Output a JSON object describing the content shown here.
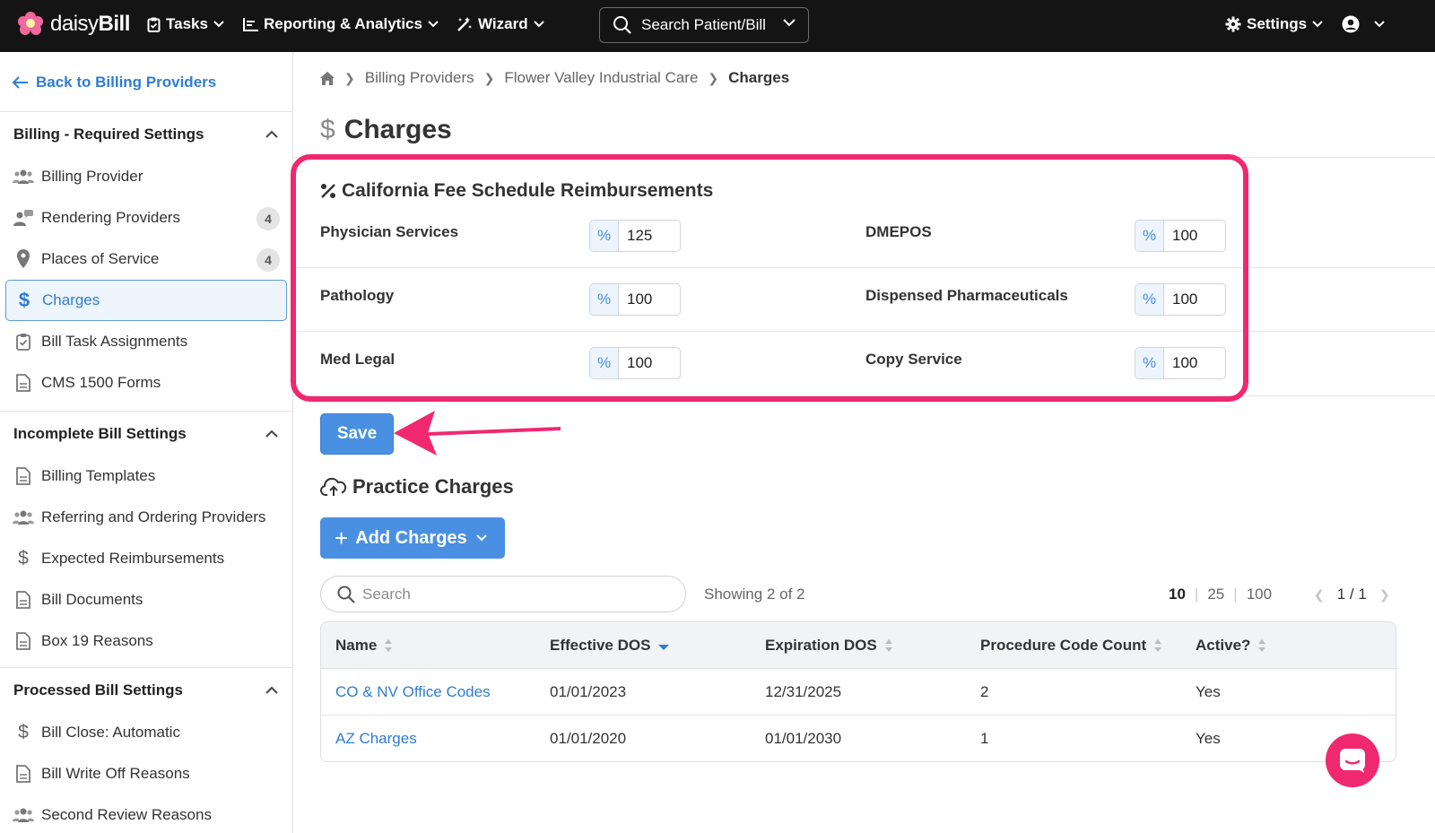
{
  "app": {
    "logo_text_light": "daisy",
    "logo_text_bold": "Bill"
  },
  "topnav": {
    "tasks": "Tasks",
    "reporting": "Reporting & Analytics",
    "wizard": "Wizard",
    "search_label": "Search Patient/Bill",
    "settings": "Settings"
  },
  "sidebar": {
    "back_link": "Back to Billing Providers",
    "sections": [
      {
        "title": "Billing - Required Settings",
        "items": [
          {
            "label": "Billing Provider",
            "icon": "users-icon"
          },
          {
            "label": "Rendering Providers",
            "icon": "user-chat-icon",
            "badge": "4"
          },
          {
            "label": "Places of Service",
            "icon": "map-pin-icon",
            "badge": "4"
          },
          {
            "label": "Charges",
            "icon": "dollar-icon",
            "active": true
          },
          {
            "label": "Bill Task Assignments",
            "icon": "clipboard-check-icon"
          },
          {
            "label": "CMS 1500 Forms",
            "icon": "document-icon"
          }
        ]
      },
      {
        "title": "Incomplete Bill Settings",
        "items": [
          {
            "label": "Billing Templates",
            "icon": "document-icon"
          },
          {
            "label": "Referring and Ordering Providers",
            "icon": "users-icon"
          },
          {
            "label": "Expected Reimbursements",
            "icon": "dollar-icon"
          },
          {
            "label": "Bill Documents",
            "icon": "document-icon"
          },
          {
            "label": "Box 19 Reasons",
            "icon": "document-icon"
          }
        ]
      },
      {
        "title": "Processed Bill Settings",
        "items": [
          {
            "label": "Bill Close: Automatic",
            "icon": "dollar-icon"
          },
          {
            "label": "Bill Write Off Reasons",
            "icon": "document-icon"
          },
          {
            "label": "Second Review Reasons",
            "icon": "users-icon"
          }
        ]
      }
    ]
  },
  "breadcrumb": [
    "Billing Providers",
    "Flower Valley Industrial Care",
    "Charges"
  ],
  "page": {
    "title_symbol": "$",
    "title": "Charges"
  },
  "fee_schedule": {
    "title": "California Fee Schedule Reimbursements",
    "percent_symbol": "%",
    "rows": [
      {
        "left_label": "Physician Services",
        "left_value": "125",
        "right_label": "DMEPOS",
        "right_value": "100"
      },
      {
        "left_label": "Pathology",
        "left_value": "100",
        "right_label": "Dispensed Pharmaceuticals",
        "right_value": "100"
      },
      {
        "left_label": "Med Legal",
        "left_value": "100",
        "right_label": "Copy Service",
        "right_value": "100"
      }
    ],
    "save_label": "Save"
  },
  "practice_charges": {
    "title": "Practice Charges",
    "add_label": "Add Charges",
    "search_placeholder": "Search",
    "showing": "Showing 2 of 2",
    "page_sizes": [
      "10",
      "25",
      "100"
    ],
    "page_indicator": "1 / 1",
    "columns": [
      "Name",
      "Effective DOS",
      "Expiration DOS",
      "Procedure Code Count",
      "Active?"
    ],
    "rows": [
      {
        "name": "CO & NV Office Codes",
        "effective": "01/01/2023",
        "expiration": "12/31/2025",
        "count": "2",
        "active": "Yes"
      },
      {
        "name": "AZ Charges",
        "effective": "01/01/2020",
        "expiration": "01/01/2030",
        "count": "1",
        "active": "Yes"
      }
    ]
  },
  "colors": {
    "accent": "#4a90e2",
    "highlight": "#f0286f",
    "topbar": "#141414"
  }
}
